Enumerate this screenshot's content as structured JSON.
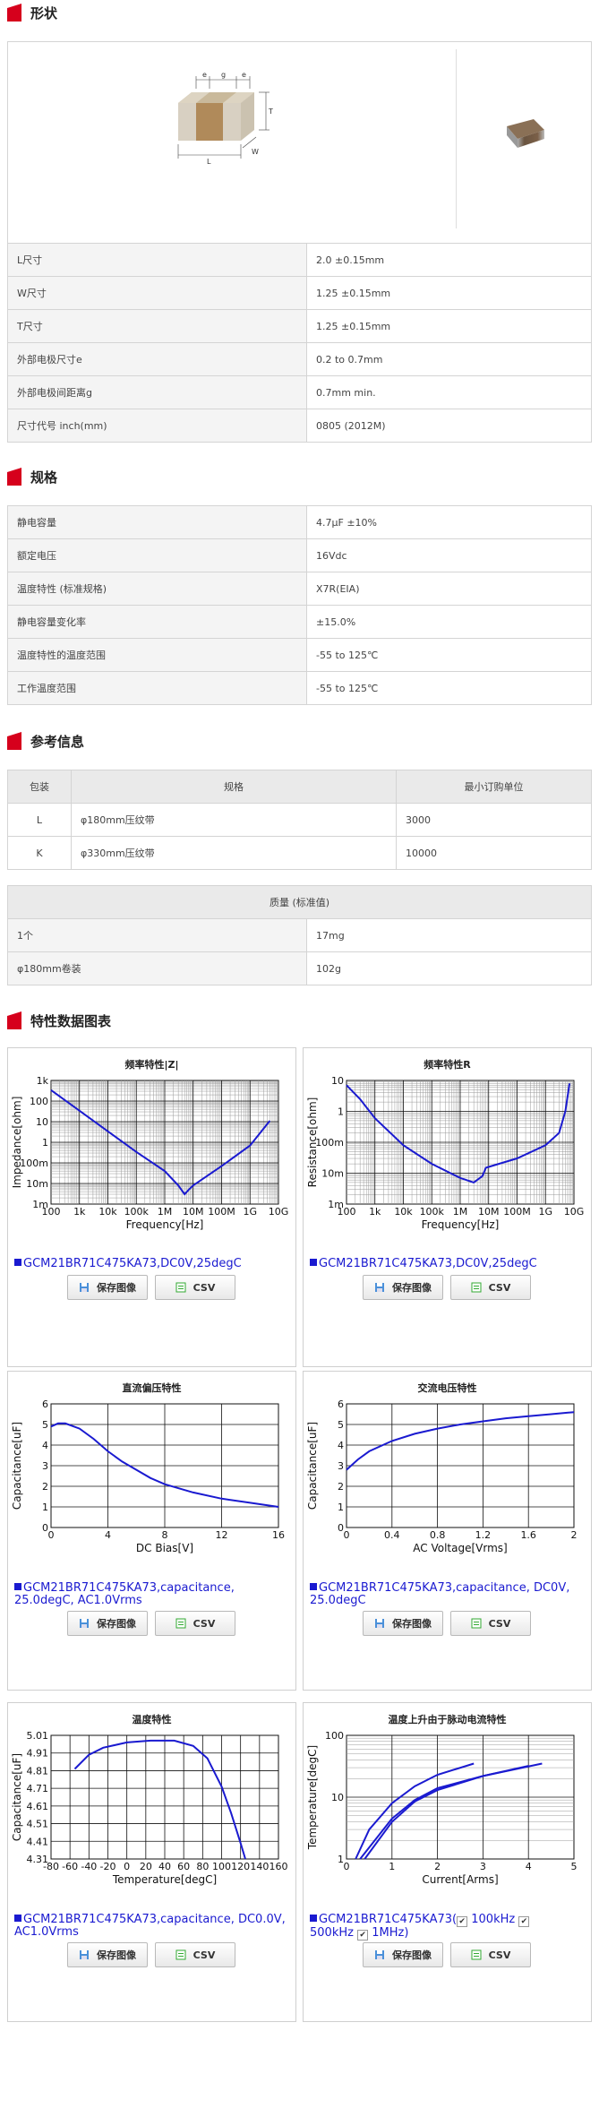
{
  "shape": {
    "title": "形状",
    "dims": {
      "e1": "e",
      "g": "g",
      "e2": "e",
      "T": "T",
      "W": "W",
      "L": "L"
    },
    "rows": [
      {
        "k": "L尺寸",
        "v": "2.0 ±0.15mm"
      },
      {
        "k": "W尺寸",
        "v": "1.25 ±0.15mm"
      },
      {
        "k": "T尺寸",
        "v": "1.25 ±0.15mm"
      },
      {
        "k": "外部电极尺寸e",
        "v": "0.2 to 0.7mm"
      },
      {
        "k": "外部电极间距离g",
        "v": "0.7mm min."
      },
      {
        "k": "尺寸代号 inch(mm)",
        "v": "0805 (2012M)"
      }
    ]
  },
  "specs": {
    "title": "规格",
    "rows": [
      {
        "k": "静电容量",
        "v": "4.7μF ±10%"
      },
      {
        "k": "额定电压",
        "v": "16Vdc"
      },
      {
        "k": "温度特性 (标准规格)",
        "v": "X7R(EIA)"
      },
      {
        "k": "静电容量变化率",
        "v": "±15.0%"
      },
      {
        "k": "温度特性的温度范围",
        "v": "-55 to 125℃"
      },
      {
        "k": "工作温度范围",
        "v": "-55 to 125℃"
      }
    ]
  },
  "reference": {
    "title": "参考信息",
    "packaging": {
      "headers": [
        "包装",
        "规格",
        "最小订购单位"
      ],
      "rows": [
        {
          "code": "L",
          "spec": "φ180mm压纹带",
          "moq": "3000"
        },
        {
          "code": "K",
          "spec": "φ330mm压纹带",
          "moq": "10000"
        }
      ]
    },
    "mass": {
      "header": "质量 (标准值)",
      "rows": [
        {
          "k": "1个",
          "v": "17mg"
        },
        {
          "k": "φ180mm卷装",
          "v": "102g"
        }
      ]
    }
  },
  "charts_section": {
    "title": "特性数据图表",
    "save_label": "保存图像",
    "csv_label": "CSV"
  },
  "colors": {
    "accent": "#d6001c",
    "curve": "#1a1ad0"
  },
  "chart_data": [
    {
      "type": "line",
      "title": "频率特性|Z|",
      "xlabel": "Frequency[Hz]",
      "ylabel": "Impedance[ohm]",
      "xscale": "log",
      "yscale": "log",
      "xlim": [
        100,
        10000000000
      ],
      "ylim": [
        0.001,
        1000
      ],
      "xticks": [
        "100",
        "1k",
        "10k",
        "100k",
        "1M",
        "10M",
        "100M",
        "1G",
        "10G"
      ],
      "yticks": [
        "1k",
        "100",
        "10",
        "1",
        "100m",
        "10m",
        "1m"
      ],
      "legend": "GCM21BR71C475KA73,DC0V,25degC",
      "series": [
        {
          "x": [
            100,
            1000,
            10000,
            100000,
            1000000,
            3000000,
            5000000,
            7000000,
            10000000,
            100000000,
            1000000000,
            5000000000
          ],
          "y": [
            340,
            34,
            3.4,
            0.34,
            0.04,
            0.008,
            0.003,
            0.005,
            0.008,
            0.07,
            0.7,
            11
          ]
        }
      ]
    },
    {
      "type": "line",
      "title": "频率特性R",
      "xlabel": "Frequency[Hz]",
      "ylabel": "Resistance[ohm]",
      "xscale": "log",
      "yscale": "log",
      "xlim": [
        100,
        10000000000
      ],
      "ylim": [
        0.001,
        10
      ],
      "xticks": [
        "100",
        "1k",
        "10k",
        "100k",
        "1M",
        "10M",
        "100M",
        "1G",
        "10G"
      ],
      "yticks": [
        "10",
        "1",
        "100m",
        "10m",
        "1m"
      ],
      "legend": "GCM21BR71C475KA73,DC0V,25degC",
      "series": [
        {
          "x": [
            100,
            300,
            1000,
            10000,
            100000,
            1000000,
            3000000,
            6000000,
            8000000,
            10000000,
            100000000,
            1000000000,
            3000000000,
            5000000000,
            7000000000
          ],
          "y": [
            7,
            2.5,
            0.6,
            0.08,
            0.02,
            0.007,
            0.005,
            0.008,
            0.015,
            0.016,
            0.03,
            0.08,
            0.2,
            1,
            8
          ]
        }
      ]
    },
    {
      "type": "line",
      "title": "直流偏压特性",
      "xlabel": "DC Bias[V]",
      "ylabel": "Capacitance[uF]",
      "xlim": [
        0,
        16
      ],
      "ylim": [
        0,
        6
      ],
      "xticks": [
        "0",
        "4",
        "8",
        "12",
        "16"
      ],
      "yticks": [
        "6",
        "5",
        "4",
        "3",
        "2",
        "1",
        "0"
      ],
      "legend": "GCM21BR71C475KA73,capacitance, 25.0degC, AC1.0Vrms",
      "series": [
        {
          "x": [
            0,
            0.5,
            1,
            2,
            3,
            4,
            5,
            6,
            7,
            8,
            10,
            12,
            14,
            16
          ],
          "y": [
            4.9,
            5.05,
            5.05,
            4.8,
            4.3,
            3.7,
            3.2,
            2.8,
            2.4,
            2.1,
            1.7,
            1.4,
            1.2,
            1.0
          ]
        }
      ]
    },
    {
      "type": "line",
      "title": "交流电压特性",
      "xlabel": "AC Voltage[Vrms]",
      "ylabel": "Capacitance[uF]",
      "xlim": [
        0,
        2
      ],
      "ylim": [
        0,
        6
      ],
      "xticks": [
        "0",
        "0.4",
        "0.8",
        "1.2",
        "1.6",
        "2"
      ],
      "yticks": [
        "6",
        "5",
        "4",
        "3",
        "2",
        "1",
        "0"
      ],
      "legend": "GCM21BR71C475KA73,capacitance, DC0V, 25.0degC",
      "series": [
        {
          "x": [
            0,
            0.1,
            0.2,
            0.4,
            0.6,
            0.8,
            1.0,
            1.2,
            1.4,
            1.6,
            1.8,
            2.0
          ],
          "y": [
            2.8,
            3.3,
            3.7,
            4.2,
            4.55,
            4.8,
            5.0,
            5.15,
            5.3,
            5.4,
            5.5,
            5.6
          ]
        }
      ]
    },
    {
      "type": "line",
      "title": "温度特性",
      "xlabel": "Temperature[degC]",
      "ylabel": "Capacitance[uF]",
      "xlim": [
        -80,
        160
      ],
      "ylim": [
        4.31,
        5.01
      ],
      "xticks": [
        "-80",
        "-60",
        "-40",
        "-20",
        "0",
        "20",
        "40",
        "60",
        "80",
        "100",
        "120",
        "140",
        "160"
      ],
      "yticks": [
        "5.01",
        "4.91",
        "4.81",
        "4.71",
        "4.61",
        "4.51",
        "4.41",
        "4.31"
      ],
      "legend": "GCM21BR71C475KA73,capacitance, DC0.0V, AC1.0Vrms",
      "series": [
        {
          "x": [
            -55,
            -40,
            -25,
            0,
            25,
            50,
            70,
            85,
            100,
            110,
            120,
            125
          ],
          "y": [
            4.82,
            4.9,
            4.94,
            4.97,
            4.98,
            4.98,
            4.95,
            4.88,
            4.72,
            4.57,
            4.4,
            4.31
          ]
        }
      ]
    },
    {
      "type": "line",
      "title": "温度上升由于脉动电流特性",
      "xlabel": "Current[Arms]",
      "ylabel": "Temperature[degC]",
      "xlim": [
        0,
        5
      ],
      "ylim": [
        1,
        100
      ],
      "yscale": "log",
      "xticks": [
        "0",
        "1",
        "2",
        "3",
        "4",
        "5"
      ],
      "yticks": [
        "100",
        "10",
        "1"
      ],
      "legend": "GCM21BR71C475KA73(",
      "options": [
        "100kHz",
        "500kHz",
        "1MHz)"
      ],
      "series": [
        {
          "name": "100kHz",
          "x": [
            0.2,
            0.5,
            1,
            1.5,
            2,
            2.8
          ],
          "y": [
            1,
            3,
            8,
            15,
            23,
            35
          ]
        },
        {
          "name": "500kHz",
          "x": [
            0.4,
            1,
            1.5,
            2,
            3,
            4.3
          ],
          "y": [
            1,
            4,
            8.5,
            13,
            22,
            35
          ]
        },
        {
          "name": "1MHz",
          "x": [
            0.3,
            1,
            1.5,
            2,
            3,
            4
          ],
          "y": [
            1,
            4.5,
            9,
            14,
            22,
            32
          ]
        }
      ]
    }
  ]
}
